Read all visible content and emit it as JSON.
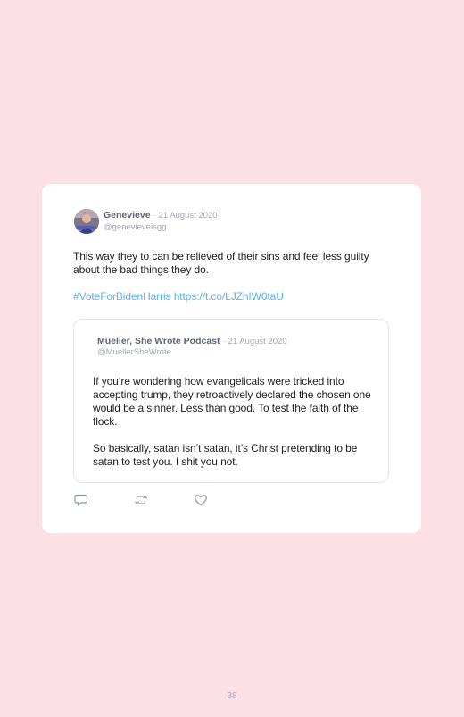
{
  "tweet": {
    "author_name": "Genevieve",
    "separator": "·",
    "date": "21 August 2020",
    "handle": "@genevieveisgg",
    "text": "This way they to can be relieved of their sins and feel less guilty about the bad things they do.",
    "hashtag": "#VoteForBidenHarris",
    "link": "https://t.co/LJZhIW0taU"
  },
  "quoted_tweet": {
    "author_name": "Mueller, She Wrote Podcast",
    "separator": "·",
    "date": "21 August 2020",
    "handle": "@MuellerSheWrote",
    "paragraph_1": "If you’re wondering how evangelicals were tricked into accepting trump, they retroactively declared the chosen one would be a sinner. Less than good. To test the faith of the flock.",
    "paragraph_2": "So basically, satan isn’t satan, it’s Christ pretending to be satan to test you. I shit you not."
  },
  "actions": {
    "reply_icon": "reply-icon",
    "retweet_icon": "retweet-icon",
    "like_icon": "heart-icon",
    "icon_color": "#8899a6"
  },
  "colors": {
    "background": "#fde0e5",
    "card": "#ffffff",
    "link": "#5cb3e8"
  },
  "page_number": "38"
}
